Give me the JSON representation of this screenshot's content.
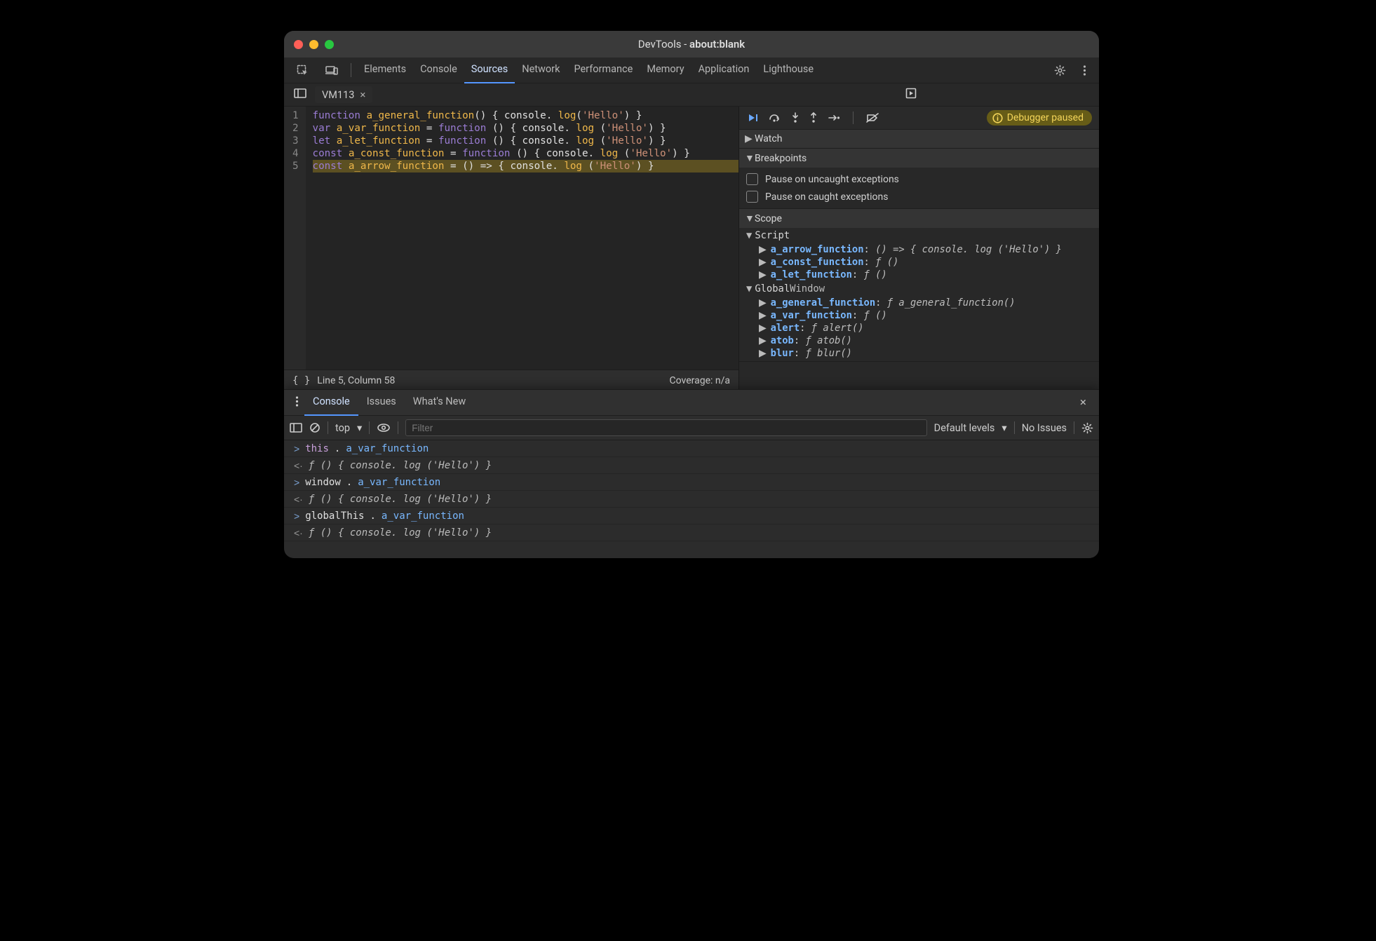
{
  "title_prefix": "DevTools - ",
  "title_url": "about:blank",
  "main_tabs": [
    "Elements",
    "Console",
    "Sources",
    "Network",
    "Performance",
    "Memory",
    "Application",
    "Lighthouse"
  ],
  "main_active": "Sources",
  "file_tab": "VM113",
  "code_lines": [
    [
      [
        "kw",
        "function"
      ],
      [
        "pl",
        " "
      ],
      [
        "fn",
        "a_general_function"
      ],
      [
        "pl",
        "() { "
      ],
      [
        "pl",
        "console"
      ],
      [
        "pl",
        ". "
      ],
      [
        "fn",
        "log"
      ],
      [
        "pl",
        "("
      ],
      [
        "str",
        "'Hello'"
      ],
      [
        "pl",
        ") }"
      ]
    ],
    [
      [
        "kw",
        "var"
      ],
      [
        "pl",
        " "
      ],
      [
        "fn",
        "a_var_function"
      ],
      [
        "pl",
        " = "
      ],
      [
        "kw",
        "function"
      ],
      [
        "pl",
        " () { "
      ],
      [
        "pl",
        "console"
      ],
      [
        "pl",
        ". "
      ],
      [
        "fn",
        "log"
      ],
      [
        "pl",
        " ("
      ],
      [
        "str",
        "'Hello'"
      ],
      [
        "pl",
        ") }"
      ]
    ],
    [
      [
        "kw",
        "let"
      ],
      [
        "pl",
        " "
      ],
      [
        "fn",
        "a_let_function"
      ],
      [
        "pl",
        " = "
      ],
      [
        "kw",
        "function"
      ],
      [
        "pl",
        " () { "
      ],
      [
        "pl",
        "console"
      ],
      [
        "pl",
        ". "
      ],
      [
        "fn",
        "log"
      ],
      [
        "pl",
        " ("
      ],
      [
        "str",
        "'Hello'"
      ],
      [
        "pl",
        ") }"
      ]
    ],
    [
      [
        "kw",
        "const"
      ],
      [
        "pl",
        " "
      ],
      [
        "fn",
        "a_const_function"
      ],
      [
        "pl",
        " = "
      ],
      [
        "kw",
        "function"
      ],
      [
        "pl",
        " () { "
      ],
      [
        "pl",
        "console"
      ],
      [
        "pl",
        ". "
      ],
      [
        "fn",
        "log"
      ],
      [
        "pl",
        " ("
      ],
      [
        "str",
        "'Hello'"
      ],
      [
        "pl",
        ") }"
      ]
    ],
    [
      [
        "kw",
        "const"
      ],
      [
        "pl",
        " "
      ],
      [
        "fn",
        "a_arrow_function"
      ],
      [
        "pl",
        " = () "
      ],
      [
        "op",
        "=>"
      ],
      [
        "pl",
        " { "
      ],
      [
        "pl",
        "console"
      ],
      [
        "pl",
        ". "
      ],
      [
        "fn",
        "log"
      ],
      [
        "pl",
        " ("
      ],
      [
        "str",
        "'Hello'"
      ],
      [
        "pl",
        ") }"
      ]
    ]
  ],
  "code_highlight": 5,
  "status_left": "Line 5, Column 58",
  "status_right": "Coverage: n/a",
  "paused_label": "Debugger paused",
  "panels": {
    "watch": "Watch",
    "breakpoints": "Breakpoints",
    "bp_opts": [
      "Pause on uncaught exceptions",
      "Pause on caught exceptions"
    ],
    "scope": "Scope",
    "script_label": "Script",
    "script_items": [
      {
        "k": "a_arrow_function",
        "v": "() => { console. log ('Hello') }"
      },
      {
        "k": "a_const_function",
        "v": "ƒ ()"
      },
      {
        "k": "a_let_function",
        "v": "ƒ ()"
      }
    ],
    "global_label": "Global",
    "global_right": "Window",
    "global_items": [
      {
        "k": "a_general_function",
        "v": "ƒ a_general_function()"
      },
      {
        "k": "a_var_function",
        "v": "ƒ ()"
      },
      {
        "k": "alert",
        "v": "ƒ alert()"
      },
      {
        "k": "atob",
        "v": "ƒ atob()"
      },
      {
        "k": "blur",
        "v": "ƒ blur()"
      }
    ]
  },
  "drawer_tabs": [
    "Console",
    "Issues",
    "What's New"
  ],
  "drawer_active": "Console",
  "console_bar": {
    "context": "top",
    "filter_placeholder": "Filter",
    "levels": "Default levels",
    "issues": "No Issues"
  },
  "console_rows": [
    {
      "dir": "in",
      "tokens": [
        [
          "id",
          "this"
        ],
        [
          "pl",
          "."
        ],
        [
          "prop",
          "a_var_function"
        ]
      ]
    },
    {
      "dir": "out",
      "tokens": [
        [
          "fnv",
          "ƒ () { console. log ('Hello') }"
        ]
      ]
    },
    {
      "dir": "in",
      "tokens": [
        [
          "pl",
          "window"
        ],
        [
          "pl",
          "."
        ],
        [
          "prop",
          "a_var_function"
        ]
      ]
    },
    {
      "dir": "out",
      "tokens": [
        [
          "fnv",
          "ƒ () { console. log ('Hello') }"
        ]
      ]
    },
    {
      "dir": "in",
      "tokens": [
        [
          "pl",
          "globalThis"
        ],
        [
          "pl",
          "."
        ],
        [
          "prop",
          "a_var_function"
        ]
      ]
    },
    {
      "dir": "out",
      "tokens": [
        [
          "fnv",
          "ƒ () { console. log ('Hello') }"
        ]
      ]
    }
  ]
}
